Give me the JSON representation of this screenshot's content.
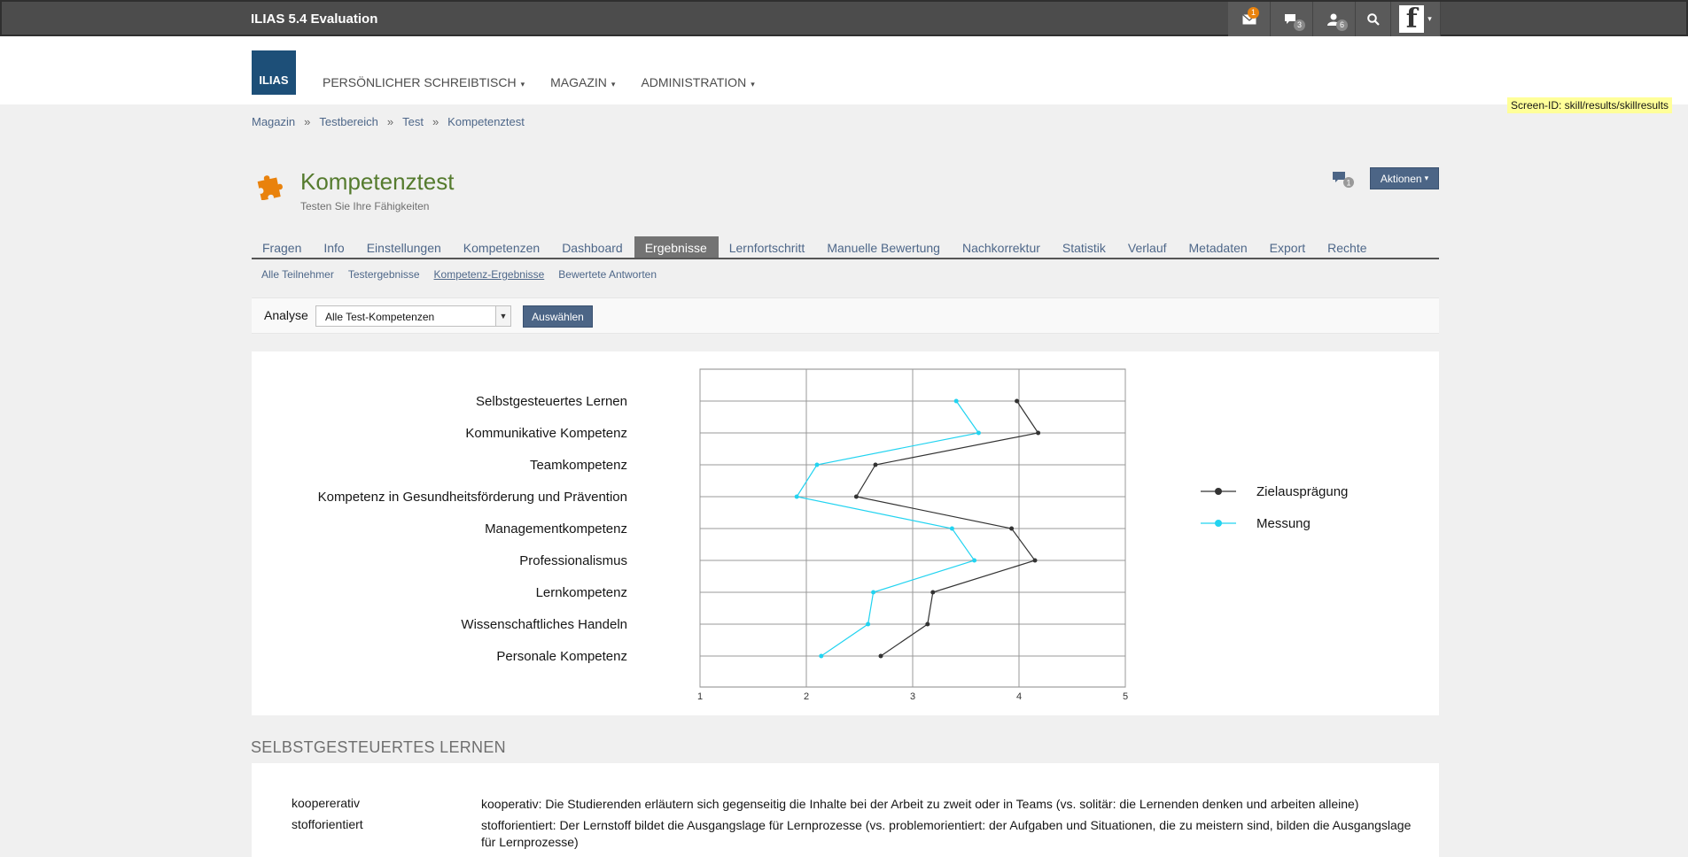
{
  "topbar": {
    "title": "ILIAS 5.4 Evaluation",
    "mail_badge": "1",
    "chat_badge": "3",
    "contacts_badge": "6"
  },
  "header": {
    "logo_text": "ILIAS",
    "nav": [
      {
        "label": "PERSÖNLICHER SCHREIBTISCH"
      },
      {
        "label": "MAGAZIN"
      },
      {
        "label": "ADMINISTRATION"
      }
    ]
  },
  "screen_id": "Screen-ID: skill/results/skillresults",
  "breadcrumb": [
    "Magazin",
    "Testbereich",
    "Test",
    "Kompetenztest"
  ],
  "breadcrumb_sep": "»",
  "page": {
    "title": "Kompetenztest",
    "description": "Testen Sie Ihre Fähigkeiten",
    "comment_count": "1",
    "actions_label": "Aktionen"
  },
  "tabs": [
    {
      "label": "Fragen",
      "active": false
    },
    {
      "label": "Info",
      "active": false
    },
    {
      "label": "Einstellungen",
      "active": false
    },
    {
      "label": "Kompetenzen",
      "active": false
    },
    {
      "label": "Dashboard",
      "active": false
    },
    {
      "label": "Ergebnisse",
      "active": true
    },
    {
      "label": "Lernfortschritt",
      "active": false
    },
    {
      "label": "Manuelle Bewertung",
      "active": false
    },
    {
      "label": "Nachkorrektur",
      "active": false
    },
    {
      "label": "Statistik",
      "active": false
    },
    {
      "label": "Verlauf",
      "active": false
    },
    {
      "label": "Metadaten",
      "active": false
    },
    {
      "label": "Export",
      "active": false
    },
    {
      "label": "Rechte",
      "active": false
    }
  ],
  "subtabs": [
    {
      "label": "Alle Teilnehmer",
      "active": false
    },
    {
      "label": "Testergebnisse",
      "active": false
    },
    {
      "label": "Kompetenz-Ergebnisse",
      "active": true
    },
    {
      "label": "Bewertete Antworten",
      "active": false
    }
  ],
  "toolbar": {
    "label": "Analyse",
    "select_value": "Alle Test-Kompetenzen",
    "button_label": "Auswählen"
  },
  "chart_data": {
    "type": "line",
    "orientation": "horizontal",
    "categories": [
      "Selbstgesteuertes Lernen",
      "Kommunikative Kompetenz",
      "Teamkompetenz",
      "Kompetenz in Gesundheitsförderung und Prävention",
      "Managementkompetenz",
      "Professionalismus",
      "Lernkompetenz",
      "Wissenschaftliches Handeln",
      "Personale Kompetenz"
    ],
    "series": [
      {
        "name": "Zielausprägung",
        "color": "#333333",
        "values": [
          3.98,
          4.18,
          2.65,
          2.47,
          3.93,
          4.15,
          3.19,
          3.14,
          2.7
        ]
      },
      {
        "name": "Messung",
        "color": "#22d3f0",
        "values": [
          3.41,
          3.62,
          2.1,
          1.91,
          3.37,
          3.58,
          2.63,
          2.58,
          2.14
        ]
      }
    ],
    "xticks": [
      "1",
      "2",
      "3",
      "4",
      "5"
    ],
    "xlim": [
      1,
      5
    ],
    "grid": true,
    "legend_position": "right"
  },
  "section": {
    "title": "SELBSTGESTEUERTES LERNEN",
    "rows": [
      {
        "term": "koopererativ",
        "desc": "kooperativ: Die Studierenden erläutern sich gegenseitig die Inhalte bei der Arbeit zu zweit oder in Teams (vs. solitär: die Lernenden denken und arbeiten alleine)"
      },
      {
        "term": "stofforientiert",
        "desc": "stofforientiert: Der Lernstoff bildet die Ausgangslage für Lernprozesse (vs. problemorientiert: der Aufgaben und Situationen, die zu meistern sind, bilden die Ausgangslage für Lernprozesse)"
      }
    ]
  }
}
